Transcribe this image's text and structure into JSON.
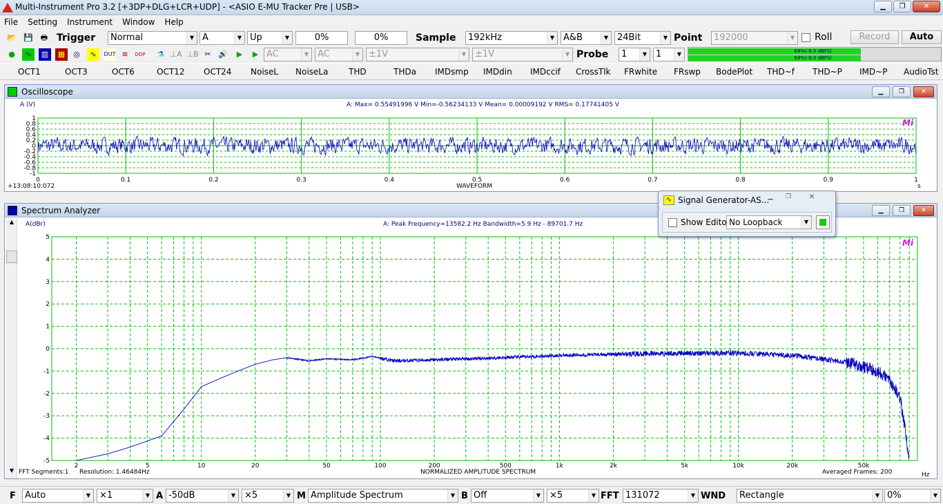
{
  "window": {
    "title": "Multi-Instrument Pro 3.2    [+3DP+DLG+LCR+UDP]   -   <ASIO E-MU Tracker Pre | USB>"
  },
  "menu": [
    "File",
    "Setting",
    "Instrument",
    "Window",
    "Help"
  ],
  "toolbar1": {
    "trigger_label": "Trigger",
    "trigger_mode": "Normal",
    "trigger_channel": "A",
    "trigger_edge": "Up",
    "trigger_level": "0%",
    "trigger_delay": "0%",
    "sample_label": "Sample",
    "sample_rate": "192kHz",
    "channels": "A&B",
    "bit_depth": "24Bit",
    "point_label": "Point",
    "points": "192000",
    "roll_label": "Roll",
    "record_label": "Record",
    "auto_label": "Auto"
  },
  "toolbar2": {
    "coupling_a": "AC",
    "coupling_b": "AC",
    "range_a": "±1V",
    "range_b": "±1V",
    "probe_label": "Probe",
    "probe_a": "1",
    "probe_b": "1",
    "meter_a": "68%(-6.0 dBFS)",
    "meter_b": "68%(-6.0 dBFS)"
  },
  "tests": [
    "OCT1",
    "OCT3",
    "OCT6",
    "OCT12",
    "OCT24",
    "NoiseL",
    "NoiseLa",
    "THD",
    "THDa",
    "IMDsmp",
    "IMDdin",
    "IMDccif",
    "CrossTlk",
    "FRwhite",
    "FRswp",
    "BodePlot",
    "THD~f",
    "THD~P",
    "IMD~P",
    "AudioTst"
  ],
  "oscilloscope": {
    "title": "Oscilloscope",
    "y_unit": "A (V)",
    "stats": "A: Max= 0.55491996 V  Min=-0.56234133 V  Mean= 0.00009192 V  RMS= 0.17741405 V",
    "timestamp": "+13:08:10:072",
    "xlabel": "WAVEFORM",
    "x_unit": "s",
    "y_ticks": [
      "1",
      "0.8",
      "0.6",
      "0.4",
      "0.2",
      "0",
      "-0.2",
      "-0.4",
      "-0.6",
      "-0.8",
      "-1"
    ],
    "x_ticks": [
      "0",
      "0.1",
      "0.2",
      "0.3",
      "0.4",
      "0.5",
      "0.6",
      "0.7",
      "0.8",
      "0.9",
      "1"
    ],
    "logo": "Mi"
  },
  "spectrum": {
    "title": "Spectrum Analyzer",
    "y_unit": "A(dBr)",
    "stats": "A: Peak Frequency=13582.2 Hz  Bandwidth=5.9 Hz - 89701.7 Hz",
    "xlabel": "NORMALIZED AMPLITUDE SPECTRUM",
    "fft_segments": "FFT Segments:1",
    "resolution": "Resolution: 1.46484Hz",
    "averaged": "Averaged Frames: 200",
    "x_unit": "Hz",
    "y_ticks": [
      "5",
      "4",
      "3",
      "2",
      "1",
      "0",
      "-1",
      "-2",
      "-3",
      "-4",
      "-5"
    ],
    "x_ticks": [
      "2",
      "5",
      "10",
      "20",
      "50",
      "100",
      "200",
      "500",
      "1k",
      "2k",
      "5k",
      "10k",
      "20k",
      "50k"
    ],
    "logo": "Mi"
  },
  "signal_generator": {
    "title": "Signal Generator-AS...",
    "show_editor": "Show Editor",
    "loopback": "No Loopback"
  },
  "bottom": {
    "f_label": "F",
    "f_value": "Auto",
    "f_zoom": "×1",
    "a_label": "A",
    "a_ref": "-50dB",
    "a_zoom": "×5",
    "m_label": "M",
    "m_value": "Amplitude Spectrum",
    "b_label": "B",
    "b_ref": "Off",
    "b_zoom": "×5",
    "fft_label": "FFT",
    "fft_size": "131072",
    "wnd_label": "WND",
    "window": "Rectangle",
    "overlap": "0%"
  },
  "colors": {
    "trace": "#0000c0",
    "grid": "#00c000",
    "meter": "#1fd41f"
  },
  "chart_data": [
    {
      "type": "line",
      "ylabel": "A (V)",
      "xlabel": "WAVEFORM",
      "xlim": [
        0,
        1
      ],
      "ylim": [
        -1,
        1
      ],
      "series": [
        {
          "values_rms": 0.17741405,
          "max": 0.55491996,
          "min": -0.56234133,
          "mean": 9.192e-05
        }
      ]
    },
    {
      "type": "line",
      "ylabel": "A(dBr)",
      "xlabel": "NORMALIZED AMPLITUDE SPECTRUM",
      "xscale": "log",
      "xlim": [
        1.46,
        100000
      ],
      "ylim": [
        -5,
        5
      ],
      "x": [
        2,
        3,
        4,
        6,
        8,
        10,
        13,
        16,
        20,
        25,
        30,
        40,
        50,
        70,
        90,
        120,
        200,
        500,
        1000,
        2000,
        5000,
        10000,
        20000,
        40000,
        60000,
        70000,
        80000,
        85000,
        90000
      ],
      "y": [
        -5,
        -4.7,
        -4.4,
        -3.9,
        -2.7,
        -1.7,
        -1.3,
        -1.0,
        -0.7,
        -0.5,
        -0.4,
        -0.55,
        -0.45,
        -0.5,
        -0.35,
        -0.55,
        -0.5,
        -0.4,
        -0.3,
        -0.25,
        -0.2,
        -0.2,
        -0.3,
        -0.6,
        -1.0,
        -1.4,
        -2.2,
        -3.5,
        -5.0
      ]
    }
  ]
}
